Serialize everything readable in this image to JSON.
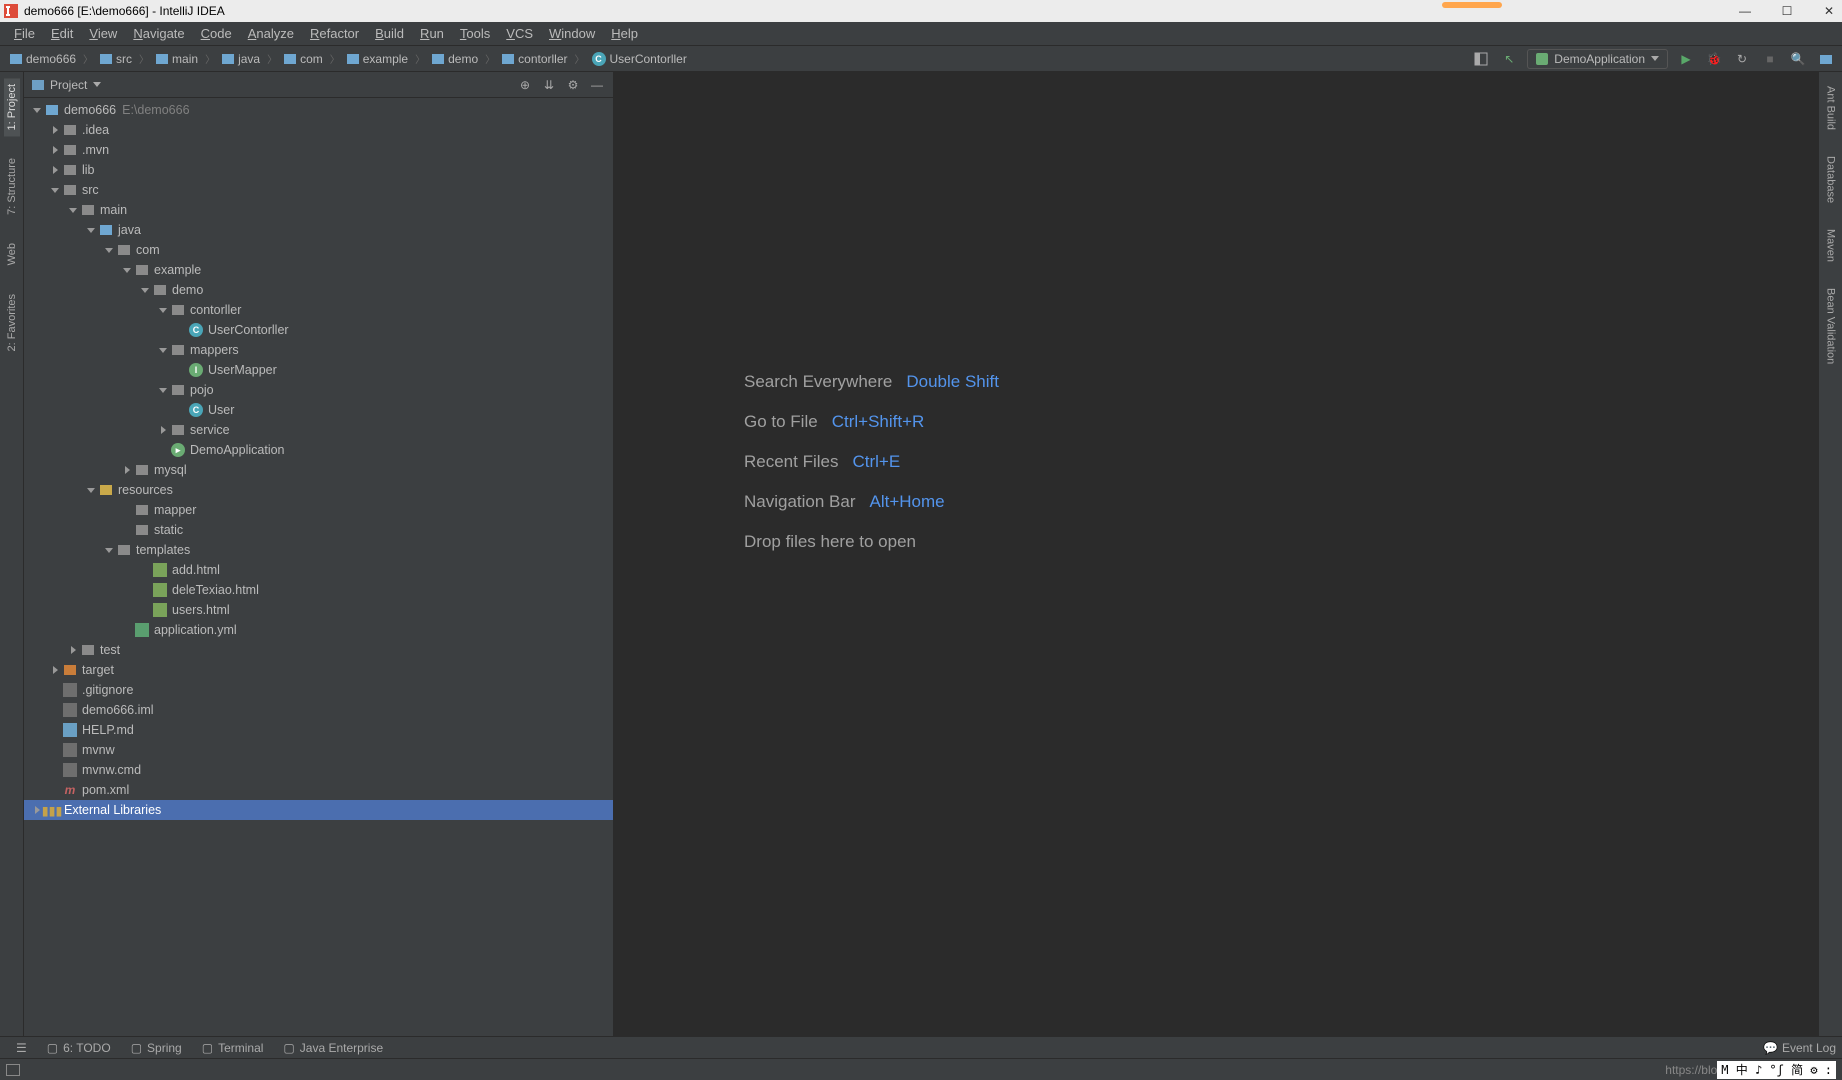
{
  "title": "demo666 [E:\\demo666] - IntelliJ IDEA",
  "menu": [
    "File",
    "Edit",
    "View",
    "Navigate",
    "Code",
    "Analyze",
    "Refactor",
    "Build",
    "Run",
    "Tools",
    "VCS",
    "Window",
    "Help"
  ],
  "breadcrumbs": [
    {
      "icon": "folder-blue",
      "label": "demo666"
    },
    {
      "icon": "folder-blue",
      "label": "src"
    },
    {
      "icon": "folder-blue",
      "label": "main"
    },
    {
      "icon": "folder-blue",
      "label": "java"
    },
    {
      "icon": "folder-blue",
      "label": "com"
    },
    {
      "icon": "folder-blue",
      "label": "example"
    },
    {
      "icon": "folder-blue",
      "label": "demo"
    },
    {
      "icon": "folder-blue",
      "label": "contorller"
    },
    {
      "icon": "class-c",
      "label": "UserContorller"
    }
  ],
  "run_config": "DemoApplication",
  "left_tabs": [
    {
      "label": "1: Project",
      "active": true
    },
    {
      "label": "7: Structure",
      "active": false
    },
    {
      "label": "Web",
      "active": false
    },
    {
      "label": "2: Favorites",
      "active": false
    }
  ],
  "right_tabs": [
    "Ant Build",
    "Database",
    "Maven",
    "Bean Validation"
  ],
  "panel_title": "Project",
  "tree": [
    {
      "d": 0,
      "a": "open",
      "i": "folder-blue",
      "l": "demo666",
      "ann": "E:\\demo666"
    },
    {
      "d": 1,
      "a": "closed",
      "i": "folder-grey",
      "l": ".idea"
    },
    {
      "d": 1,
      "a": "closed",
      "i": "folder-grey",
      "l": ".mvn"
    },
    {
      "d": 1,
      "a": "closed",
      "i": "folder-grey",
      "l": "lib"
    },
    {
      "d": 1,
      "a": "open",
      "i": "folder-grey",
      "l": "src"
    },
    {
      "d": 2,
      "a": "open",
      "i": "folder-grey",
      "l": "main"
    },
    {
      "d": 3,
      "a": "open",
      "i": "folder-blue",
      "l": "java"
    },
    {
      "d": 4,
      "a": "open",
      "i": "folder-grey",
      "l": "com"
    },
    {
      "d": 5,
      "a": "open",
      "i": "folder-grey",
      "l": "example"
    },
    {
      "d": 6,
      "a": "open",
      "i": "folder-grey",
      "l": "demo"
    },
    {
      "d": 7,
      "a": "open",
      "i": "folder-grey",
      "l": "contorller"
    },
    {
      "d": 8,
      "a": "",
      "i": "class-c",
      "l": "UserContorller"
    },
    {
      "d": 7,
      "a": "open",
      "i": "folder-grey",
      "l": "mappers"
    },
    {
      "d": 8,
      "a": "",
      "i": "class-i",
      "l": "UserMapper"
    },
    {
      "d": 7,
      "a": "open",
      "i": "folder-grey",
      "l": "pojo"
    },
    {
      "d": 8,
      "a": "",
      "i": "class-c",
      "l": "User"
    },
    {
      "d": 7,
      "a": "closed",
      "i": "folder-grey",
      "l": "service"
    },
    {
      "d": 7,
      "a": "",
      "i": "class-sb",
      "l": "DemoApplication"
    },
    {
      "d": 5,
      "a": "closed",
      "i": "folder-grey",
      "l": "mysql"
    },
    {
      "d": 3,
      "a": "open",
      "i": "folder-res",
      "l": "resources"
    },
    {
      "d": 5,
      "a": "",
      "i": "folder-grey",
      "l": "mapper"
    },
    {
      "d": 5,
      "a": "",
      "i": "folder-grey",
      "l": "static"
    },
    {
      "d": 4,
      "a": "open",
      "i": "folder-grey",
      "l": "templates"
    },
    {
      "d": 6,
      "a": "",
      "i": "file-html",
      "l": "add.html"
    },
    {
      "d": 6,
      "a": "",
      "i": "file-html",
      "l": "deleTexiao.html"
    },
    {
      "d": 6,
      "a": "",
      "i": "file-html",
      "l": "users.html"
    },
    {
      "d": 5,
      "a": "",
      "i": "file-yml",
      "l": "application.yml"
    },
    {
      "d": 2,
      "a": "closed",
      "i": "folder-grey",
      "l": "test"
    },
    {
      "d": 1,
      "a": "closed",
      "i": "folder-orange",
      "l": "target"
    },
    {
      "d": 1,
      "a": "",
      "i": "file",
      "l": ".gitignore"
    },
    {
      "d": 1,
      "a": "",
      "i": "file",
      "l": "demo666.iml"
    },
    {
      "d": 1,
      "a": "",
      "i": "file-md",
      "l": "HELP.md"
    },
    {
      "d": 1,
      "a": "",
      "i": "file",
      "l": "mvnw"
    },
    {
      "d": 1,
      "a": "",
      "i": "file",
      "l": "mvnw.cmd"
    },
    {
      "d": 1,
      "a": "",
      "i": "mvn",
      "l": "pom.xml"
    },
    {
      "d": 0,
      "a": "closed",
      "i": "lib",
      "l": "External Libraries",
      "sel": true
    }
  ],
  "welcome": [
    {
      "t": "Search Everywhere",
      "k": "Double Shift"
    },
    {
      "t": "Go to File",
      "k": "Ctrl+Shift+R"
    },
    {
      "t": "Recent Files",
      "k": "Ctrl+E"
    },
    {
      "t": "Navigation Bar",
      "k": "Alt+Home"
    },
    {
      "t": "Drop files here to open",
      "k": ""
    }
  ],
  "bottom_tabs": [
    "6: TODO",
    "Spring",
    "Terminal",
    "Java Enterprise"
  ],
  "event_log": "Event Log",
  "status_url": "https://blo",
  "ime": "M 中 ♪ °ʃ 简 ⚙ :"
}
